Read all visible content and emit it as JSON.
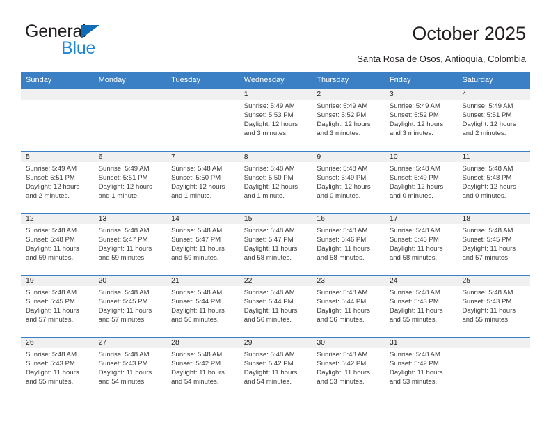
{
  "brand": {
    "name_part1": "General",
    "name_part2": "Blue",
    "accent_color": "#2186d6",
    "triangle_color": "#0f6cb5"
  },
  "header": {
    "title": "October 2025",
    "subtitle": "Santa Rosa de Osos, Antioquia, Colombia"
  },
  "theme": {
    "header_bg": "#3b7fc4",
    "header_text": "#ffffff",
    "day_strip_bg": "#f0f0f0",
    "grid_line": "#3b7fc4",
    "body_text": "#3a3a3a"
  },
  "weekdays": [
    "Sunday",
    "Monday",
    "Tuesday",
    "Wednesday",
    "Thursday",
    "Friday",
    "Saturday"
  ],
  "weeks": [
    [
      {
        "day": "",
        "lines": []
      },
      {
        "day": "",
        "lines": []
      },
      {
        "day": "",
        "lines": []
      },
      {
        "day": "1",
        "lines": [
          "Sunrise: 5:49 AM",
          "Sunset: 5:53 PM",
          "Daylight: 12 hours",
          "and 3 minutes."
        ]
      },
      {
        "day": "2",
        "lines": [
          "Sunrise: 5:49 AM",
          "Sunset: 5:52 PM",
          "Daylight: 12 hours",
          "and 3 minutes."
        ]
      },
      {
        "day": "3",
        "lines": [
          "Sunrise: 5:49 AM",
          "Sunset: 5:52 PM",
          "Daylight: 12 hours",
          "and 3 minutes."
        ]
      },
      {
        "day": "4",
        "lines": [
          "Sunrise: 5:49 AM",
          "Sunset: 5:51 PM",
          "Daylight: 12 hours",
          "and 2 minutes."
        ]
      }
    ],
    [
      {
        "day": "5",
        "lines": [
          "Sunrise: 5:49 AM",
          "Sunset: 5:51 PM",
          "Daylight: 12 hours",
          "and 2 minutes."
        ]
      },
      {
        "day": "6",
        "lines": [
          "Sunrise: 5:49 AM",
          "Sunset: 5:51 PM",
          "Daylight: 12 hours",
          "and 1 minute."
        ]
      },
      {
        "day": "7",
        "lines": [
          "Sunrise: 5:48 AM",
          "Sunset: 5:50 PM",
          "Daylight: 12 hours",
          "and 1 minute."
        ]
      },
      {
        "day": "8",
        "lines": [
          "Sunrise: 5:48 AM",
          "Sunset: 5:50 PM",
          "Daylight: 12 hours",
          "and 1 minute."
        ]
      },
      {
        "day": "9",
        "lines": [
          "Sunrise: 5:48 AM",
          "Sunset: 5:49 PM",
          "Daylight: 12 hours",
          "and 0 minutes."
        ]
      },
      {
        "day": "10",
        "lines": [
          "Sunrise: 5:48 AM",
          "Sunset: 5:49 PM",
          "Daylight: 12 hours",
          "and 0 minutes."
        ]
      },
      {
        "day": "11",
        "lines": [
          "Sunrise: 5:48 AM",
          "Sunset: 5:48 PM",
          "Daylight: 12 hours",
          "and 0 minutes."
        ]
      }
    ],
    [
      {
        "day": "12",
        "lines": [
          "Sunrise: 5:48 AM",
          "Sunset: 5:48 PM",
          "Daylight: 11 hours",
          "and 59 minutes."
        ]
      },
      {
        "day": "13",
        "lines": [
          "Sunrise: 5:48 AM",
          "Sunset: 5:47 PM",
          "Daylight: 11 hours",
          "and 59 minutes."
        ]
      },
      {
        "day": "14",
        "lines": [
          "Sunrise: 5:48 AM",
          "Sunset: 5:47 PM",
          "Daylight: 11 hours",
          "and 59 minutes."
        ]
      },
      {
        "day": "15",
        "lines": [
          "Sunrise: 5:48 AM",
          "Sunset: 5:47 PM",
          "Daylight: 11 hours",
          "and 58 minutes."
        ]
      },
      {
        "day": "16",
        "lines": [
          "Sunrise: 5:48 AM",
          "Sunset: 5:46 PM",
          "Daylight: 11 hours",
          "and 58 minutes."
        ]
      },
      {
        "day": "17",
        "lines": [
          "Sunrise: 5:48 AM",
          "Sunset: 5:46 PM",
          "Daylight: 11 hours",
          "and 58 minutes."
        ]
      },
      {
        "day": "18",
        "lines": [
          "Sunrise: 5:48 AM",
          "Sunset: 5:45 PM",
          "Daylight: 11 hours",
          "and 57 minutes."
        ]
      }
    ],
    [
      {
        "day": "19",
        "lines": [
          "Sunrise: 5:48 AM",
          "Sunset: 5:45 PM",
          "Daylight: 11 hours",
          "and 57 minutes."
        ]
      },
      {
        "day": "20",
        "lines": [
          "Sunrise: 5:48 AM",
          "Sunset: 5:45 PM",
          "Daylight: 11 hours",
          "and 57 minutes."
        ]
      },
      {
        "day": "21",
        "lines": [
          "Sunrise: 5:48 AM",
          "Sunset: 5:44 PM",
          "Daylight: 11 hours",
          "and 56 minutes."
        ]
      },
      {
        "day": "22",
        "lines": [
          "Sunrise: 5:48 AM",
          "Sunset: 5:44 PM",
          "Daylight: 11 hours",
          "and 56 minutes."
        ]
      },
      {
        "day": "23",
        "lines": [
          "Sunrise: 5:48 AM",
          "Sunset: 5:44 PM",
          "Daylight: 11 hours",
          "and 56 minutes."
        ]
      },
      {
        "day": "24",
        "lines": [
          "Sunrise: 5:48 AM",
          "Sunset: 5:43 PM",
          "Daylight: 11 hours",
          "and 55 minutes."
        ]
      },
      {
        "day": "25",
        "lines": [
          "Sunrise: 5:48 AM",
          "Sunset: 5:43 PM",
          "Daylight: 11 hours",
          "and 55 minutes."
        ]
      }
    ],
    [
      {
        "day": "26",
        "lines": [
          "Sunrise: 5:48 AM",
          "Sunset: 5:43 PM",
          "Daylight: 11 hours",
          "and 55 minutes."
        ]
      },
      {
        "day": "27",
        "lines": [
          "Sunrise: 5:48 AM",
          "Sunset: 5:43 PM",
          "Daylight: 11 hours",
          "and 54 minutes."
        ]
      },
      {
        "day": "28",
        "lines": [
          "Sunrise: 5:48 AM",
          "Sunset: 5:42 PM",
          "Daylight: 11 hours",
          "and 54 minutes."
        ]
      },
      {
        "day": "29",
        "lines": [
          "Sunrise: 5:48 AM",
          "Sunset: 5:42 PM",
          "Daylight: 11 hours",
          "and 54 minutes."
        ]
      },
      {
        "day": "30",
        "lines": [
          "Sunrise: 5:48 AM",
          "Sunset: 5:42 PM",
          "Daylight: 11 hours",
          "and 53 minutes."
        ]
      },
      {
        "day": "31",
        "lines": [
          "Sunrise: 5:48 AM",
          "Sunset: 5:42 PM",
          "Daylight: 11 hours",
          "and 53 minutes."
        ]
      },
      {
        "day": "",
        "lines": []
      }
    ]
  ]
}
